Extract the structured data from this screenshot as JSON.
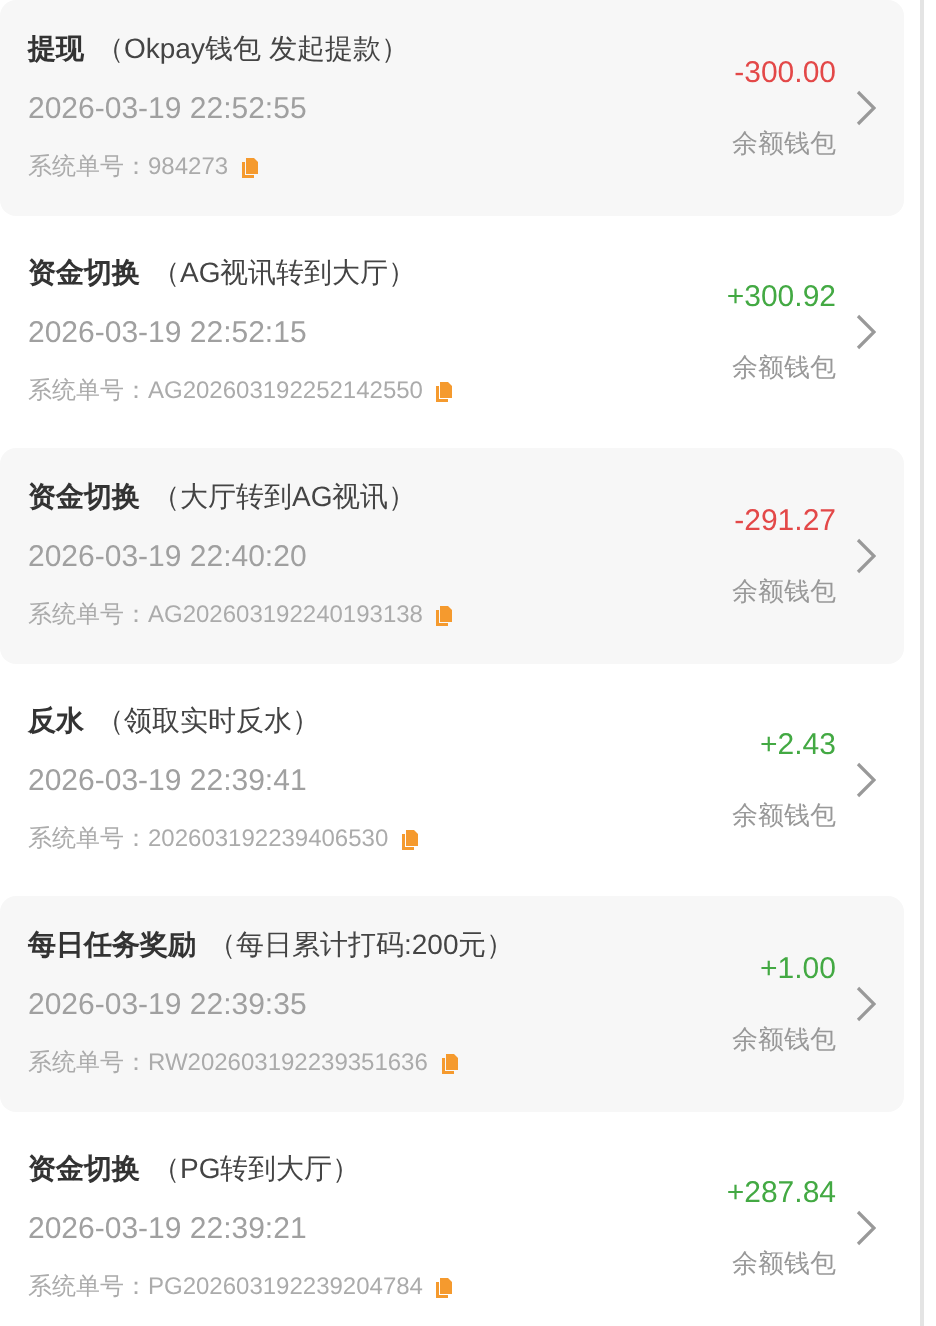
{
  "records": [
    {
      "type": "提现",
      "note": "（Okpay钱包 发起提款）",
      "time": "2026-03-19 22:52:55",
      "order_label": "系统单号：",
      "order_no": "984273",
      "amount": "-300.00",
      "kind": "debit",
      "wallet": "余额钱包"
    },
    {
      "type": "资金切换",
      "note": "（AG视讯转到大厅）",
      "time": "2026-03-19 22:52:15",
      "order_label": "系统单号：",
      "order_no": "AG202603192252142550",
      "amount": "+300.92",
      "kind": "credit",
      "wallet": "余额钱包"
    },
    {
      "type": "资金切换",
      "note": "（大厅转到AG视讯）",
      "time": "2026-03-19 22:40:20",
      "order_label": "系统单号：",
      "order_no": "AG202603192240193138",
      "amount": "-291.27",
      "kind": "debit",
      "wallet": "余额钱包"
    },
    {
      "type": "反水",
      "note": "（领取实时反水）",
      "time": "2026-03-19 22:39:41",
      "order_label": "系统单号：",
      "order_no": "202603192239406530",
      "amount": "+2.43",
      "kind": "credit",
      "wallet": "余额钱包"
    },
    {
      "type": "每日任务奖励",
      "note": "（每日累计打码:200元）",
      "time": "2026-03-19 22:39:35",
      "order_label": "系统单号：",
      "order_no": "RW202603192239351636",
      "amount": "+1.00",
      "kind": "credit",
      "wallet": "余额钱包"
    },
    {
      "type": "资金切换",
      "note": "（PG转到大厅）",
      "time": "2026-03-19 22:39:21",
      "order_label": "系统单号：",
      "order_no": "PG202603192239204784",
      "amount": "+287.84",
      "kind": "credit",
      "wallet": "余额钱包"
    }
  ]
}
